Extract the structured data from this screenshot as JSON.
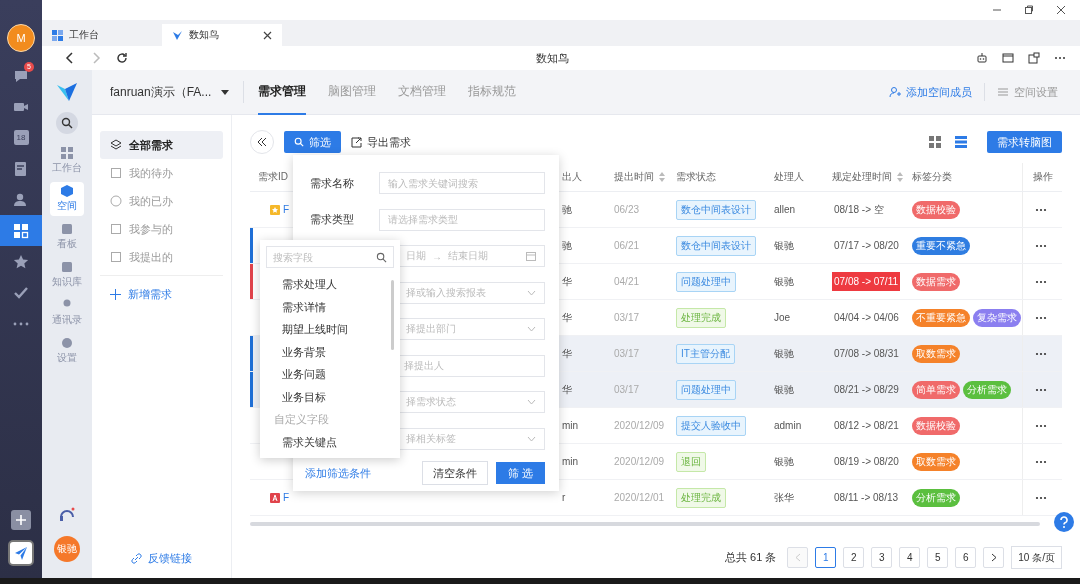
{
  "rail": {
    "avatar": "M",
    "items": [
      {
        "kind": "chat",
        "badge": "5",
        "selected": false
      },
      {
        "kind": "video",
        "selected": false
      },
      {
        "kind": "calendar",
        "text": "18",
        "selected": false
      },
      {
        "kind": "approval",
        "selected": false
      },
      {
        "kind": "contacts",
        "selected": false
      },
      {
        "kind": "apps",
        "selected": true
      },
      {
        "kind": "star",
        "selected": false
      },
      {
        "kind": "check",
        "selected": false
      },
      {
        "kind": "more",
        "selected": false
      }
    ]
  },
  "browser_tabs": [
    {
      "label": "工作台",
      "selected": false
    },
    {
      "label": "数知鸟",
      "selected": true
    }
  ],
  "address_bar": {
    "title": "数知鸟"
  },
  "app_nav": {
    "items": [
      {
        "label": "工作台",
        "kind": "workbench",
        "selected": false
      },
      {
        "label": "空间",
        "kind": "space",
        "selected": true
      },
      {
        "label": "看板",
        "kind": "board",
        "selected": false
      },
      {
        "label": "知识库",
        "kind": "library",
        "selected": false
      },
      {
        "label": "通讯录",
        "kind": "contacts",
        "selected": false
      },
      {
        "label": "设置",
        "kind": "settings",
        "selected": false
      }
    ],
    "avatar": "银驰"
  },
  "header": {
    "workspace": "fanruan演示（FA...",
    "tabs": [
      {
        "label": "需求管理",
        "selected": true
      },
      {
        "label": "脑图管理",
        "selected": false
      },
      {
        "label": "文档管理",
        "selected": false
      },
      {
        "label": "指标规范",
        "selected": false
      }
    ],
    "actions": [
      {
        "label": "添加空间成员",
        "kind": "member"
      },
      {
        "label": "空间设置",
        "kind": "settings"
      }
    ]
  },
  "sidebar": {
    "items": [
      {
        "label": "全部需求",
        "kind": "all",
        "selected": true
      },
      {
        "label": "我的待办",
        "kind": "todo",
        "selected": false
      },
      {
        "label": "我的已办",
        "kind": "done",
        "selected": false
      },
      {
        "label": "我参与的",
        "kind": "joined",
        "selected": false
      },
      {
        "label": "我提出的",
        "kind": "raised",
        "selected": false
      }
    ],
    "add": "新增需求",
    "feedback": "反馈链接"
  },
  "toolbar": {
    "filter": "筛选",
    "export": "导出需求",
    "views": [
      {
        "kind": "grid",
        "selected": false
      },
      {
        "kind": "list",
        "selected": true
      }
    ],
    "mindmap": "需求转脑图"
  },
  "table": {
    "columns": [
      {
        "label": "需求ID"
      },
      {
        "label": "出人"
      },
      {
        "label": "提出时间",
        "sortable": true
      },
      {
        "label": "需求状态"
      },
      {
        "label": "处理人"
      },
      {
        "label": "规定处理时间",
        "sortable": true
      },
      {
        "label": "标签分类"
      },
      {
        "label": "操作"
      }
    ],
    "rows": [
      {
        "id": {
          "kind": "star",
          "text": "F"
        },
        "proposer": "驰",
        "date": "06/23",
        "status": {
          "label": "数仓中间表设计",
          "kind": "progress"
        },
        "handler": "allen",
        "deadline": "08/18 -> 空",
        "overdue": false,
        "highlighted": false,
        "tags": [
          {
            "label": "数据校验",
            "color": "#f06a6a"
          }
        ]
      },
      {
        "color": "#1f6fd6",
        "proposer": "驰",
        "date": "06/21",
        "status": {
          "label": "数仓中间表设计",
          "kind": "progress"
        },
        "handler": "银驰",
        "deadline": "07/17 -> 08/20",
        "overdue": false,
        "highlighted": false,
        "tags": [
          {
            "label": "重要不紧急",
            "color": "#2f7de1"
          }
        ]
      },
      {
        "color": "#e0434b",
        "proposer": "华",
        "date": "04/21",
        "status": {
          "label": "问题处理中",
          "kind": "progress"
        },
        "handler": "银驰",
        "deadline": "07/08 -> 07/11",
        "overdue": true,
        "highlighted": false,
        "tags": [
          {
            "label": "数据需求",
            "color": "#f06a6a"
          }
        ]
      },
      {
        "proposer": "华",
        "date": "03/17",
        "status": {
          "label": "处理完成",
          "kind": "done"
        },
        "handler": "Joe",
        "deadline": "04/04 -> 04/06",
        "overdue": false,
        "highlighted": false,
        "tags": [
          {
            "label": "不重要紧急",
            "color": "#f5822a"
          },
          {
            "label": "复杂需求",
            "color": "#8b7ff0"
          }
        ]
      },
      {
        "color": "#1f6fd6",
        "proposer": "华",
        "date": "03/17",
        "status": {
          "label": "IT主管分配",
          "kind": "progress"
        },
        "handler": "银驰",
        "deadline": "07/08 -> 08/31",
        "overdue": false,
        "highlighted": true,
        "tags": [
          {
            "label": "取数需求",
            "color": "#f5822a"
          }
        ]
      },
      {
        "color": "#1f6fd6",
        "proposer": "华",
        "date": "03/17",
        "status": {
          "label": "问题处理中",
          "kind": "progress"
        },
        "handler": "银驰",
        "deadline": "08/21 -> 08/29",
        "overdue": false,
        "highlighted": true,
        "tags": [
          {
            "label": "简单需求",
            "color": "#f06a6a"
          },
          {
            "label": "分析需求",
            "color": "#5bbf3f"
          }
        ]
      },
      {
        "proposer": "min",
        "date": "2020/12/09",
        "status": {
          "label": "提交人验收中",
          "kind": "progress"
        },
        "handler": "admin",
        "deadline": "08/12 -> 08/21",
        "overdue": false,
        "highlighted": false,
        "tags": [
          {
            "label": "数据校验",
            "color": "#f06a6a"
          }
        ]
      },
      {
        "proposer": "min",
        "date": "2020/12/09",
        "status": {
          "label": "退回",
          "kind": "done"
        },
        "handler": "银驰",
        "deadline": "08/19 -> 08/20",
        "overdue": false,
        "highlighted": false,
        "tags": [
          {
            "label": "取数需求",
            "color": "#f5822a"
          }
        ]
      },
      {
        "id": {
          "kind": "doc",
          "text": "F"
        },
        "proposer": "r",
        "date": "2020/12/01",
        "status": {
          "label": "处理完成",
          "kind": "done"
        },
        "handler": "张华",
        "deadline": "08/11 -> 08/13",
        "overdue": false,
        "highlighted": false,
        "tags": [
          {
            "label": "分析需求",
            "color": "#5bbf3f"
          }
        ]
      }
    ]
  },
  "filter_panel": {
    "fields": [
      {
        "kind": "text",
        "label": "需求名称",
        "placeholder": "输入需求关键词搜索"
      },
      {
        "kind": "text",
        "label": "需求类型",
        "placeholder": "请选择需求类型"
      },
      {
        "kind": "date",
        "start": "日期",
        "separator": "→",
        "end": "结束日期"
      },
      {
        "kind": "select",
        "placeholder": "择或输入搜索报表"
      },
      {
        "kind": "select",
        "placeholder": "择提出部门"
      },
      {
        "kind": "text",
        "placeholder": "择提出人"
      },
      {
        "kind": "select",
        "placeholder": "择需求状态"
      },
      {
        "kind": "select",
        "placeholder": "择相关标签"
      }
    ],
    "add": "添加筛选条件",
    "clear": "清空条件",
    "apply": "筛 选"
  },
  "field_menu": {
    "placeholder": "搜索字段",
    "items": [
      {
        "label": "需求处理人",
        "kind": "item"
      },
      {
        "label": "需求详情",
        "kind": "item"
      },
      {
        "label": "期望上线时间",
        "kind": "item"
      },
      {
        "label": "业务背景",
        "kind": "item"
      },
      {
        "label": "业务问题",
        "kind": "item"
      },
      {
        "label": "业务目标",
        "kind": "item"
      },
      {
        "label": "自定义字段",
        "kind": "group"
      },
      {
        "label": "需求关键点",
        "kind": "item"
      }
    ]
  },
  "pagination": {
    "total": "总共 61 条",
    "prev_disabled": true,
    "pages": [
      {
        "label": "1",
        "selected": true
      },
      {
        "label": "2",
        "selected": false
      },
      {
        "label": "3",
        "selected": false
      },
      {
        "label": "4",
        "selected": false
      },
      {
        "label": "5",
        "selected": false
      },
      {
        "label": "6",
        "selected": false
      }
    ],
    "page_size": "10 条/页"
  }
}
